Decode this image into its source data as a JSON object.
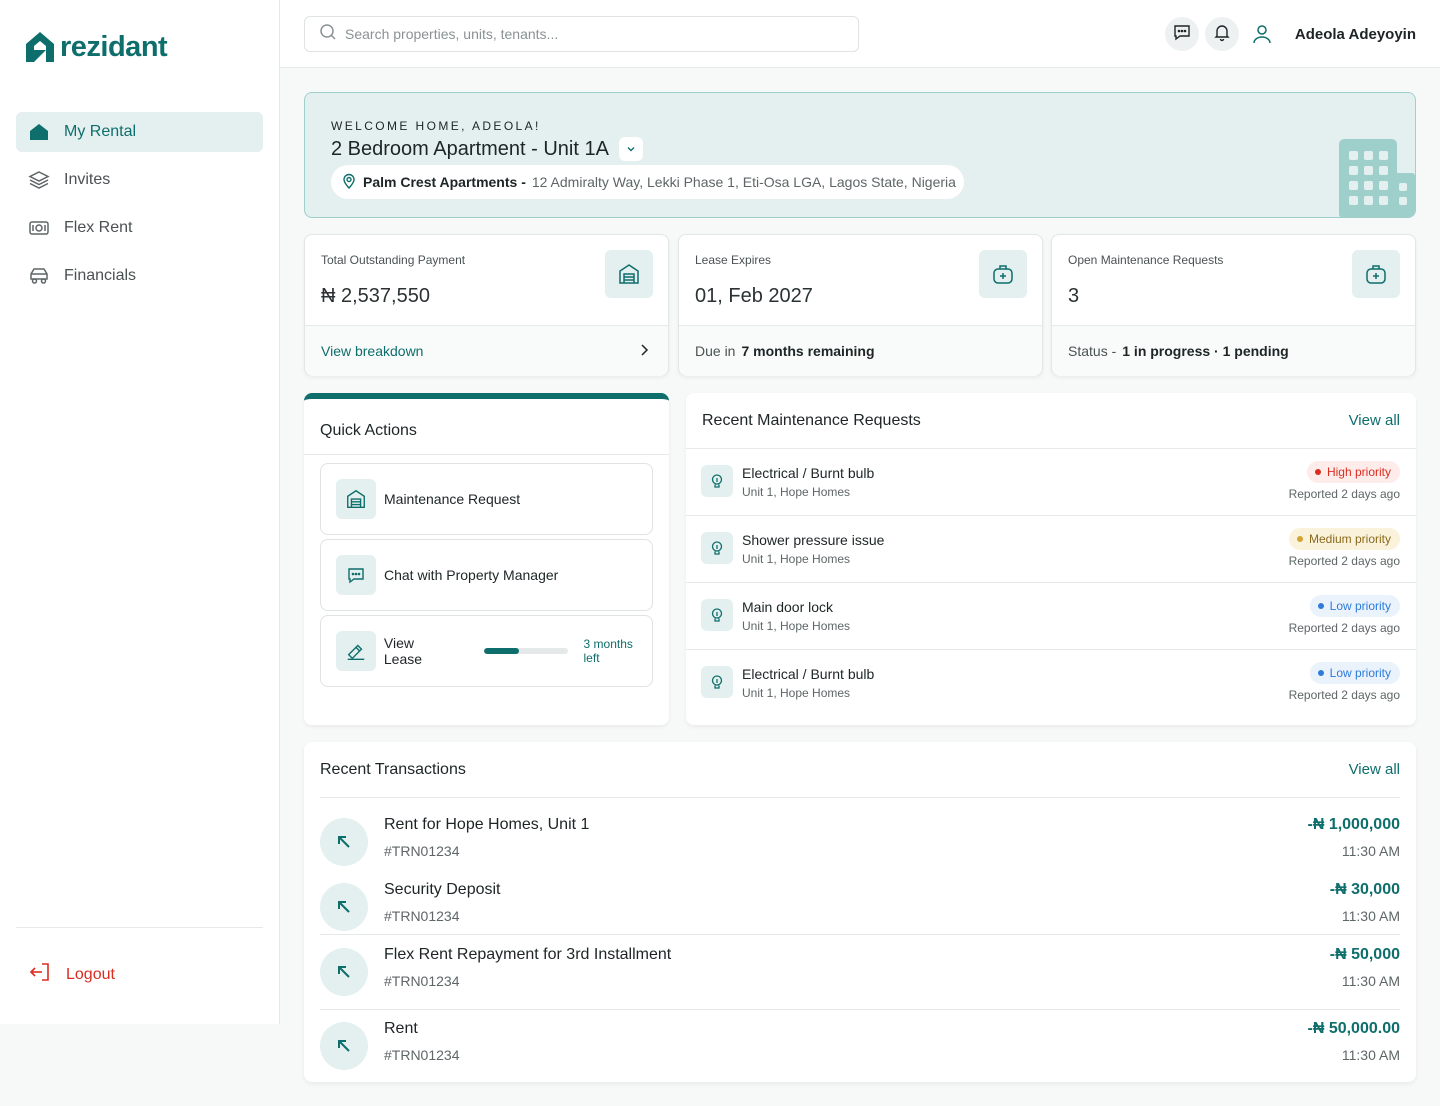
{
  "brand": {
    "name": "rezidant",
    "accent": "#0e6e6b"
  },
  "sidebar": {
    "items": [
      {
        "label": "My Rental",
        "icon": "home-icon",
        "active": true
      },
      {
        "label": "Invites",
        "icon": "layers-icon"
      },
      {
        "label": "Flex Rent",
        "icon": "money-icon"
      },
      {
        "label": "Financials",
        "icon": "car-icon"
      }
    ],
    "logout": "Logout"
  },
  "topbar": {
    "search_placeholder": "Search properties, units, tenants...",
    "user_name": "Adeola Adeyoyin"
  },
  "welcome": {
    "eyebrow": "WELCOME HOME, ADEOLA!",
    "title": "2 Bedroom Apartment - Unit 1A",
    "property_name": "Palm Crest Apartments -",
    "address": "12 Admiralty Way, Lekki Phase 1, Eti-Osa LGA, Lagos State, Nigeria"
  },
  "stats": {
    "outstanding": {
      "label": "Total Outstanding Payment",
      "value": "₦ 2,537,550",
      "link": "View breakdown"
    },
    "lease": {
      "label": "Lease Expires",
      "value": "01, Feb 2027",
      "foot_prefix": "Due in",
      "foot_value": "7 months remaining"
    },
    "maintenance": {
      "label": "Open Maintenance Requests",
      "value": "3",
      "foot_prefix": "Status -",
      "foot_value": "1 in progress · 1 pending"
    }
  },
  "quick_actions": {
    "title": "Quick Actions",
    "items": [
      {
        "label": "Maintenance Request"
      },
      {
        "label": "Chat with Property Manager"
      },
      {
        "label": "View Lease",
        "progress_text": "3 months left",
        "progress_fraction": 0.42
      }
    ]
  },
  "maintenance": {
    "title": "Recent Maintenance Requests",
    "view_all": "View all",
    "rows": [
      {
        "title": "Electrical / Burnt bulb",
        "sub": "Unit 1, Hope Homes",
        "priority": "High priority",
        "date": "Reported 2 days ago"
      },
      {
        "title": "Shower pressure issue",
        "sub": "Unit 1, Hope Homes",
        "priority": "Medium priority",
        "date": "Reported 2 days ago"
      },
      {
        "title": "Main door lock",
        "sub": "Unit 1, Hope Homes",
        "priority": "Low priority",
        "date": "Reported 2 days ago"
      },
      {
        "title": "Electrical / Burnt bulb",
        "sub": "Unit 1, Hope Homes",
        "priority": "Low priority",
        "date": "Reported 2 days ago"
      }
    ],
    "priority_colors": {
      "high": "#d92d20",
      "medium": "#d6a432",
      "low": "#2e7bd9"
    }
  },
  "transactions": {
    "title": "Recent Transactions",
    "view_all": "View all",
    "rows": [
      {
        "title": "Rent for Hope Homes, Unit 1",
        "ref": "#TRN01234",
        "amount": "-₦ 1,000,000",
        "time": "11:30 AM"
      },
      {
        "title": "Security Deposit",
        "ref": "#TRN01234",
        "amount": "-₦ 30,000",
        "time": "11:30 AM"
      },
      {
        "title": "Flex Rent Repayment for 3rd Installment",
        "ref": "#TRN01234",
        "amount": "-₦ 50,000",
        "time": "11:30 AM"
      },
      {
        "title": "Rent",
        "ref": "#TRN01234",
        "amount": "-₦ 50,000.00",
        "time": "11:30 AM"
      }
    ]
  }
}
